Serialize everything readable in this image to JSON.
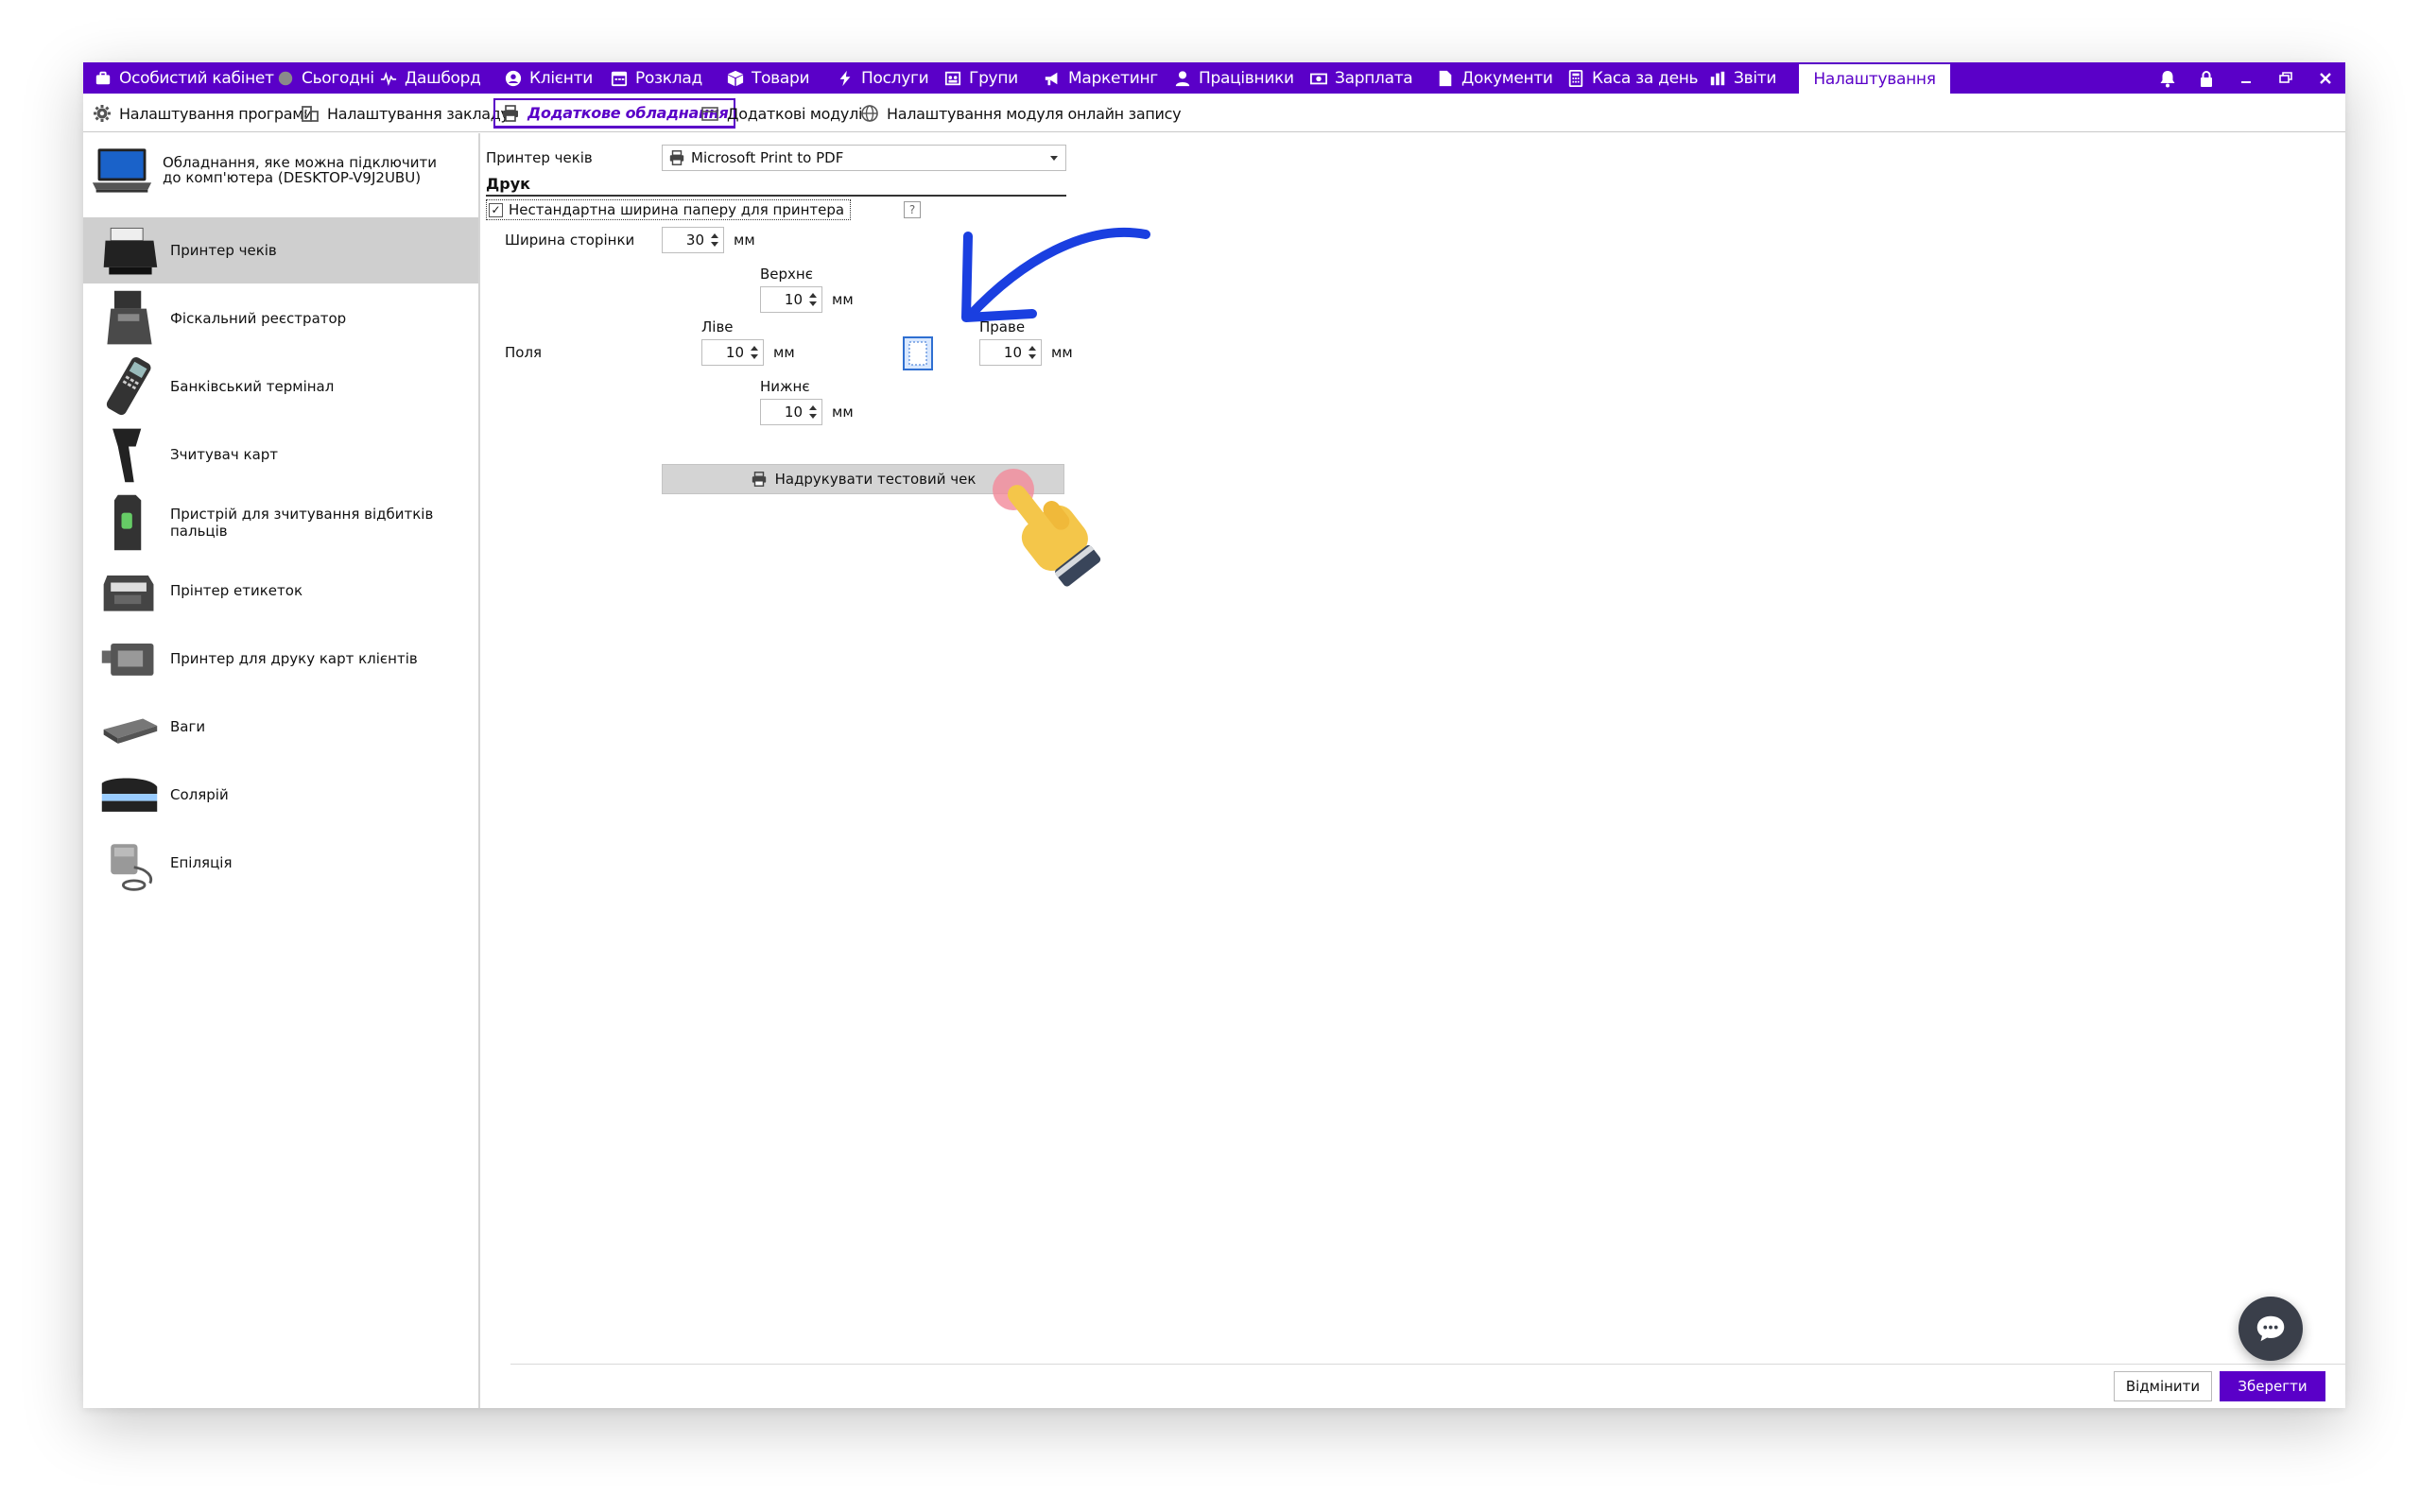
{
  "topnav": {
    "items": [
      {
        "label": "Особистий кабінет",
        "icon": "cabinet-icon"
      },
      {
        "label": "Сьогодні",
        "icon": "clock-icon"
      },
      {
        "label": "Дашборд",
        "icon": "pulse-icon"
      },
      {
        "label": "Клієнти",
        "icon": "user-circle-icon"
      },
      {
        "label": "Розклад",
        "icon": "calendar-icon"
      },
      {
        "label": "Товари",
        "icon": "box-icon"
      },
      {
        "label": "Послуги",
        "icon": "lightning-icon"
      },
      {
        "label": "Групи",
        "icon": "group-icon"
      },
      {
        "label": "Маркетинг",
        "icon": "megaphone-icon"
      },
      {
        "label": "Працівники",
        "icon": "person-icon"
      },
      {
        "label": "Зарплата",
        "icon": "money-icon"
      },
      {
        "label": "Документи",
        "icon": "document-icon"
      },
      {
        "label": "Каса за день",
        "icon": "calculator-icon"
      },
      {
        "label": "Звіти",
        "icon": "bar-chart-icon"
      },
      {
        "label": "Налаштування",
        "icon": ""
      }
    ],
    "active": "Налаштування"
  },
  "subtabs": [
    {
      "label": "Налаштування програми",
      "icon": "gear-icon"
    },
    {
      "label": "Налаштування закладу",
      "icon": "building-icon"
    },
    {
      "label": "Додаткове обладнання",
      "icon": "printer-icon"
    },
    {
      "label": "Додаткові модулі",
      "icon": "module-icon"
    },
    {
      "label": "Налаштування модуля онлайн запису",
      "icon": "globe-icon"
    }
  ],
  "sidebar": {
    "header": "Обладнання, яке можна підключити до комп'ютера (DESKTOP-V9J2UBU)",
    "items": [
      {
        "label": "Принтер чеків",
        "icon": "receipt-printer-icon",
        "selected": true
      },
      {
        "label": "Фіскальний реєстратор",
        "icon": "fiscal-register-icon",
        "selected": false
      },
      {
        "label": "Банківський термінал",
        "icon": "bank-terminal-icon",
        "selected": false
      },
      {
        "label": "Зчитувач карт",
        "icon": "card-reader-icon",
        "selected": false
      },
      {
        "label": "Пристрій для зчитування відбитків пальців",
        "icon": "fingerprint-reader-icon",
        "selected": false
      },
      {
        "label": "Прінтер етикеток",
        "icon": "label-printer-icon",
        "selected": false
      },
      {
        "label": "Принтер для друку карт клієнтів",
        "icon": "card-printer-icon",
        "selected": false
      },
      {
        "label": "Ваги",
        "icon": "scales-icon",
        "selected": false
      },
      {
        "label": "Солярій",
        "icon": "solarium-icon",
        "selected": false
      },
      {
        "label": "Епіляція",
        "icon": "epilation-icon",
        "selected": false
      }
    ]
  },
  "settings": {
    "printer_label": "Принтер чеків",
    "printer_value": "Microsoft Print to PDF",
    "print_section": "Друк",
    "custom_width_label": "Нестандартна ширина паперу для принтера",
    "custom_width_checked": true,
    "help": "?",
    "page_width_label": "Ширина сторінки",
    "page_width_value": "30",
    "unit": "мм",
    "margins_label": "Поля",
    "top_label": "Верхнє",
    "top_value": "10",
    "left_label": "Ліве",
    "left_value": "10",
    "right_label": "Праве",
    "right_value": "10",
    "bottom_label": "Нижнє",
    "bottom_value": "10",
    "print_test_button": "Надрукувати тестовий чек"
  },
  "footer": {
    "cancel": "Відмінити",
    "save": "Зберегти"
  },
  "colors": {
    "brand": "#5a00c8",
    "selected_bg": "#cfcfcf",
    "annotation_arrow": "#1a3fe0"
  }
}
